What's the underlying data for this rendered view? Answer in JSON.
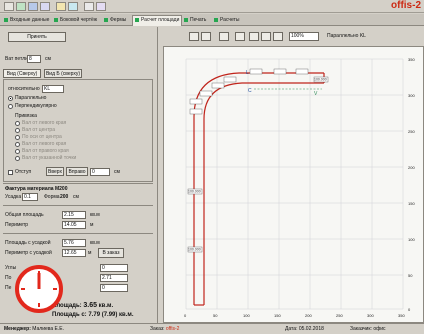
{
  "app": {
    "brand": "offis-2"
  },
  "tabs": [
    {
      "label": "Входные данные"
    },
    {
      "label": "Боковой чертёж"
    },
    {
      "label": "Фермы"
    },
    {
      "label": "Расчет площади"
    },
    {
      "label": "Печать"
    },
    {
      "label": "Расчеты"
    }
  ],
  "left": {
    "apply_button": "Принять",
    "width_label": "Ват петли",
    "width_value": "8",
    "width_unit": "см",
    "subtabs": [
      "Вид (Сверху)",
      "Вид Б (сверху)"
    ],
    "relative_label": "относительно",
    "relative_value": "KL",
    "orientation": [
      "Параллельно",
      "Перпендикулярно"
    ],
    "snap_title": "Привязка",
    "snap_items": [
      "Вал от левого края",
      "Вал от центра",
      "По оси от центра",
      "Вал от левого края",
      "Вал от правого края",
      "Вал от указанной точки"
    ],
    "indent_label": "Отступ",
    "indent_buttons": [
      "Вверх",
      "Вправо"
    ],
    "indent_value": "0",
    "indent_unit": "см",
    "material_label": "Фактура материала",
    "material_code": "М200",
    "step_label": "Усадка",
    "step_value": "0.1",
    "shape_label": "Форма",
    "shape_value": "200",
    "shape_unit": "см",
    "area_label": "Общая площадь",
    "area_value": "2.15",
    "area_unit": "кв.м",
    "perimeter_label": "Периметр",
    "perimeter_value": "14.05",
    "perimeter_unit": "м",
    "fill_area_label": "Площадь с усадкой",
    "fill_area_value": "5.76",
    "fill_area_unit": "кв.м",
    "fill_per_label": "Периметр с усадкой",
    "fill_per_value": "12.65",
    "fill_per_unit": "м",
    "fill_button": "В заказ",
    "corners_label": "Углы",
    "corners_value": "0",
    "row2_label": "По",
    "row2_value": "2.71",
    "row3_label": "Пе",
    "row3_value": "0",
    "summary1_label": "Площадь:",
    "summary1_value": "3.65",
    "summary1_unit": "кв.м.",
    "summary2_label": "Площадь с:",
    "summary2_value": "7.79 (7.99) кв.м."
  },
  "canvas_top": {
    "zoom_value": "100%",
    "mode_label": "Параллельно KL"
  },
  "drawing": {
    "right_ticks": [
      "350",
      "300",
      "250",
      "200",
      "150",
      "100",
      "50",
      "0"
    ],
    "bottom_ticks": [
      "0",
      "50",
      "100",
      "150",
      "200",
      "250",
      "300",
      "350"
    ],
    "side_labels": [
      "100.000",
      "100.000",
      "100.000"
    ],
    "point_labels": [
      "L",
      "C",
      "V"
    ]
  },
  "status": {
    "manager_label": "Менеджер:",
    "manager_value": "Малиева Е.Е.",
    "order_label": "Заказ:",
    "order_value": "offis-2",
    "date_label": "Дата:",
    "date_value": "05.02.2018",
    "client_label": "Заказчик:",
    "client_value": "офис"
  },
  "colors": {
    "accent": "#cc2a14",
    "tab_dot": "#26a650",
    "clock": "#e2281c",
    "outline": "#c0241b"
  }
}
